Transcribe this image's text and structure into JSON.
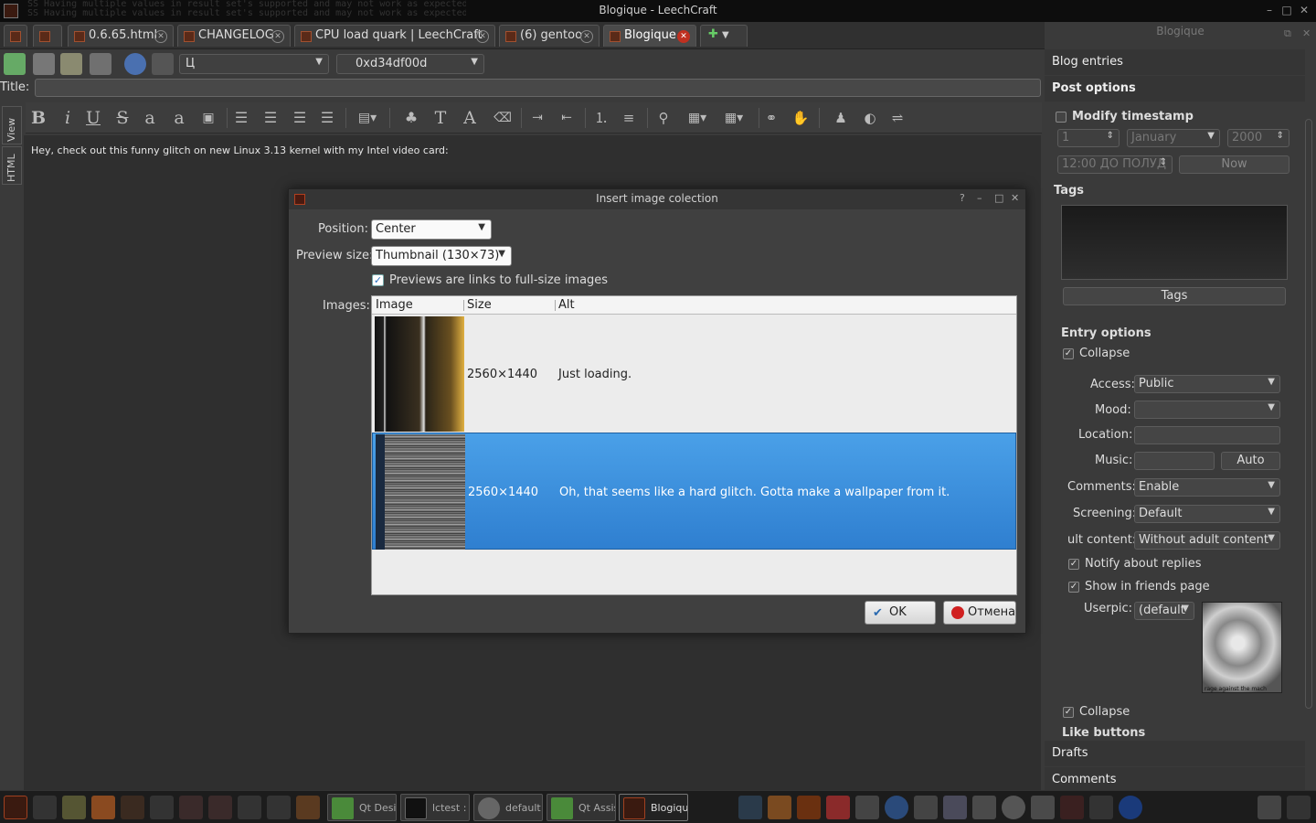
{
  "window": {
    "title": "Blogique - LeechCraft",
    "ghost_lines": [
      "SS Having multiple values in result set's supported and may not work as expected",
      "SS Having multiple values in result set's supported and may not work as expected"
    ]
  },
  "tabs": [
    {
      "label": ""
    },
    {
      "label": ""
    },
    {
      "label": "0.6.65.html"
    },
    {
      "label": "CHANGELOG"
    },
    {
      "label": "CPU load quark | LeechCraft"
    },
    {
      "label": "(6) gentoo"
    },
    {
      "label": "Blogique"
    }
  ],
  "toolbar": {
    "account": "Ц",
    "profile": "0xd34df00d"
  },
  "post": {
    "title_label": "Title:",
    "title_value": "",
    "body_text": "Hey, check out this funny glitch on new Linux 3.13 kernel with my Intel video card:",
    "view_tabs": [
      "View",
      "HTML"
    ]
  },
  "dock": {
    "title": "Blogique",
    "sections": {
      "blog_entries": "Blog entries",
      "post_options": "Post options",
      "drafts": "Drafts",
      "comments": "Comments",
      "like_buttons": "Like buttons"
    },
    "modify_timestamp": "Modify timestamp",
    "day": "1",
    "month": "January",
    "year": "2000",
    "time": "12:00 ДО ПОЛУД",
    "now_button": "Now",
    "tags_heading": "Tags",
    "tags_button": "Tags",
    "entry_options": "Entry options",
    "collapse": "Collapse",
    "access_label": "Access:",
    "access_value": "Public",
    "mood_label": "Mood:",
    "mood_value": "",
    "location_label": "Location:",
    "music_label": "Music:",
    "auto_button": "Auto",
    "comments_label": "Comments:",
    "comments_value": "Enable",
    "screening_label": "Screening:",
    "screening_value": "Default",
    "adult_label": "ult content:",
    "adult_value": "Without adult content",
    "notify": "Notify about replies",
    "friends": "Show in friends page",
    "userpic_label": "Userpic:",
    "userpic_value": "(default",
    "collapse2": "Collapse",
    "userpic_caption": "rage against the mach"
  },
  "dialog": {
    "title": "Insert image colection",
    "position_label": "Position:",
    "position_value": "Center",
    "preview_label": "Preview size:",
    "preview_value": "Thumbnail (130×73)",
    "links_label": "Previews are links to full-size images",
    "images_label": "Images:",
    "columns": [
      "Image",
      "Size",
      "Alt"
    ],
    "rows": [
      {
        "size": "2560×1440",
        "alt": "Just loading."
      },
      {
        "size": "2560×1440",
        "alt": "Oh, that seems like a hard glitch. Gotta make a wallpaper from it."
      }
    ],
    "ok": "OK",
    "cancel": "Отмена"
  },
  "taskbar": {
    "tasks": [
      "Qt Desig...",
      "lctest : s...",
      "default:...",
      "Qt Assis...",
      "Blogiqu..."
    ]
  },
  "colors": {
    "accent": "#3a8ee0",
    "brand": "#c8481e"
  }
}
